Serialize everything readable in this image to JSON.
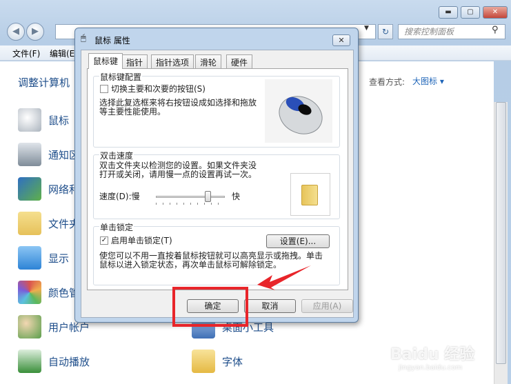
{
  "bg_window": {
    "minimize": "▬",
    "maximize": "▢",
    "close": "✕",
    "back": "◀",
    "forward": "▶",
    "refresh": "↻",
    "search_placeholder": "搜索控制面板",
    "menu": [
      "文件(F)",
      "编辑(E)"
    ],
    "page_title": "调整计算机",
    "view_by_label": "查看方式:",
    "view_by_value": "大图标 ▾",
    "items_left": [
      {
        "label": "鼠标",
        "icon": "mouse-icon",
        "color": "#b9c2cc"
      },
      {
        "label": "通知区",
        "icon": "notification-area-icon",
        "color": "#7f8c99"
      },
      {
        "label": "网络和",
        "icon": "network-icon",
        "color": "#2f6fc2"
      },
      {
        "label": "文件夹",
        "icon": "folder-options-icon",
        "color": "#e6c15a"
      },
      {
        "label": "显示",
        "icon": "display-icon",
        "color": "#2d83d6"
      },
      {
        "label": "颜色管",
        "icon": "color-management-icon",
        "color": "#d9534f"
      },
      {
        "label": "用户帐户",
        "icon": "user-accounts-icon",
        "color": "#5a9e4b"
      },
      {
        "label": "自动播放",
        "icon": "autoplay-icon",
        "color": "#3a8f3a"
      }
    ],
    "items_right": [
      {
        "label": "桌面小工具",
        "icon": "gadgets-icon",
        "color": "#3f6fb5"
      },
      {
        "label": "字体",
        "icon": "fonts-icon",
        "color": "#e5b943"
      }
    ]
  },
  "dialog": {
    "title": "鼠标 属性",
    "close": "✕",
    "tabs": [
      "鼠标键",
      "指针",
      "指针选项",
      "滑轮",
      "硬件"
    ],
    "button_config": {
      "title": "鼠标键配置",
      "checkbox_label": "切换主要和次要的按钮(S)",
      "description_1": "选择此复选框来将右按钮设成如选择和拖放",
      "description_2": "等主要性能使用。"
    },
    "double_click": {
      "title": "双击速度",
      "description_1": "双击文件夹以检测您的设置。如果文件夹没",
      "description_2": "打开或关闭，请用慢一点的设置再试一次。",
      "speed_label": "速度(D):慢",
      "fast_label": "快",
      "slider_value": 0.75
    },
    "click_lock": {
      "title": "单击锁定",
      "checkbox_label": "启用单击锁定(T)",
      "settings_button": "设置(E)...",
      "description_1": "使您可以不用一直按着鼠标按钮就可以高亮显示或拖拽。单击",
      "description_2": "鼠标以进入锁定状态，再次单击鼠标可解除锁定。"
    },
    "ok_button": "确定",
    "cancel_button": "取消",
    "apply_button": "应用(A)"
  },
  "watermark": "Baidu 经验",
  "watermark_sub": "jingyan.baidu.com",
  "colors": {
    "highlight_box": "#e8252a",
    "link": "#1d4d8a"
  }
}
